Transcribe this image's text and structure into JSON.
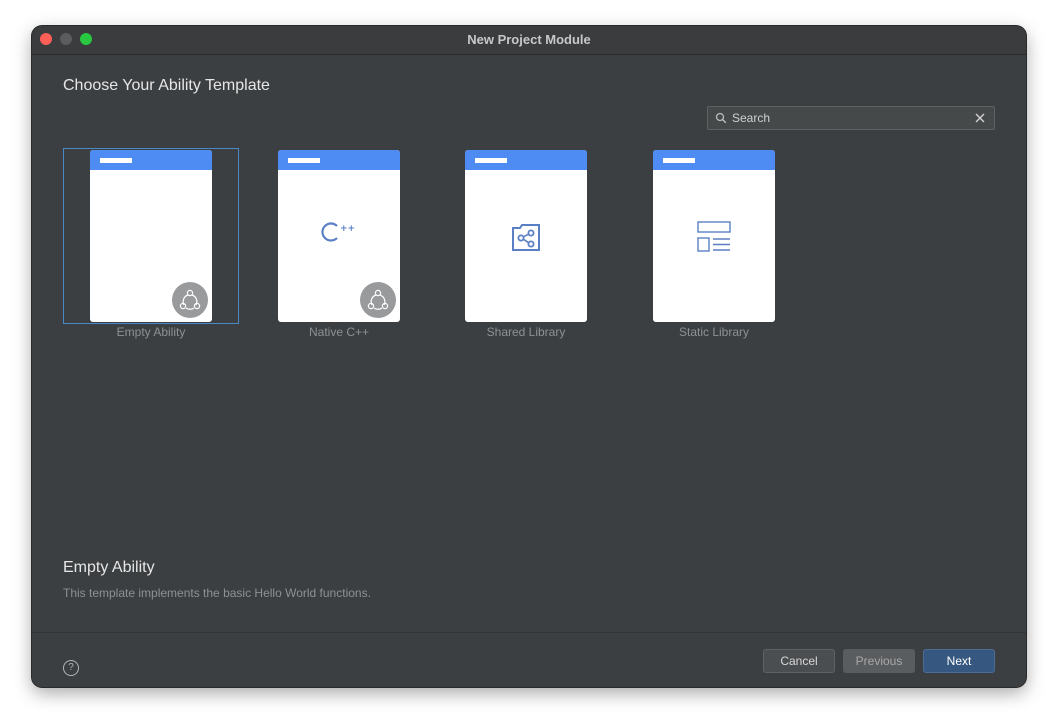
{
  "window": {
    "title": "New Project Module"
  },
  "heading": "Choose Your Ability Template",
  "search": {
    "value": "Search"
  },
  "templates": [
    {
      "label": "Empty Ability",
      "icon": "ability-badge-icon",
      "selected": true
    },
    {
      "label": "Native C++",
      "icon": "cpp-icon",
      "icon_text": "C++",
      "selected": false
    },
    {
      "label": "Shared Library",
      "icon": "shared-library-icon",
      "selected": false
    },
    {
      "label": "Static Library",
      "icon": "static-library-icon",
      "selected": false
    }
  ],
  "description": {
    "title": "Empty Ability",
    "text": "This template implements the basic Hello World functions."
  },
  "footer": {
    "help_icon": "?",
    "cancel_label": "Cancel",
    "previous_label": "Previous",
    "next_label": "Next"
  },
  "colors": {
    "accent": "#4e8cf3",
    "selection": "#4a88c7",
    "primary_button": "#365880",
    "background": "#3c3f41"
  }
}
